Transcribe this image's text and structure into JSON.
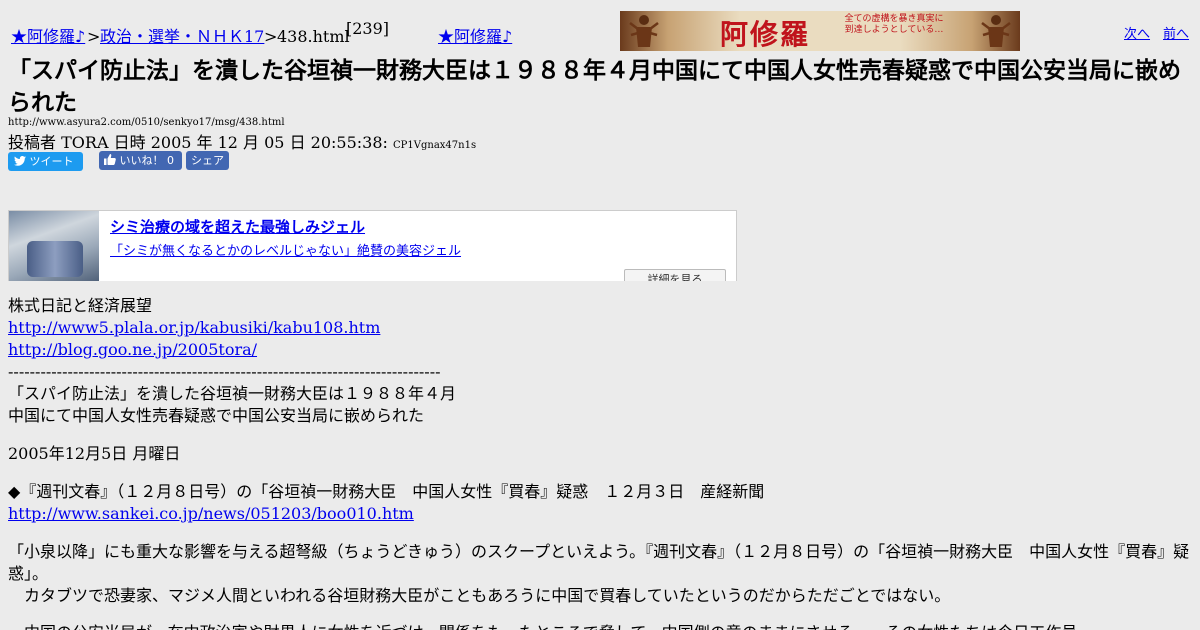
{
  "breadcrumb": {
    "home": "★阿修羅♪",
    "sep1": ">",
    "board": "政治・選挙・ＮＨＫ17",
    "sep2": ">",
    "page": "438.html",
    "count": "[239]",
    "home2": "★阿修羅♪"
  },
  "banner": {
    "title": "阿修羅",
    "tagline": "全ての虚構を暴き真実に到達しようとしている…"
  },
  "nav": {
    "next": "次へ",
    "prev": "前へ"
  },
  "headline": "「スパイ防止法」を潰した谷垣禎一財務大臣は１９８８年４月中国にて中国人女性売春疑惑で中国公安当局に嵌められた",
  "source_url": "http://www.asyura2.com/0510/senkyo17/msg/438.html",
  "post": {
    "prefix": "投稿者",
    "author": "TORA",
    "date_label": "日時",
    "date": "2005 年 12 月 05 日 20:55:38:",
    "id": "CP1Vgnax47n1s"
  },
  "social": {
    "tweet": "ツイート",
    "like": "いいね！",
    "like_count": "0",
    "share": "シェア"
  },
  "ad": {
    "title": "シミ治療の域を超えた最強しみジェル",
    "desc": "「シミが無くなるとかのレベルじゃない」絶賛の美容ジェル",
    "more": "詳細を見る"
  },
  "content": {
    "blog_name": "株式日記と経済展望",
    "link1": "http://www5.plala.or.jp/kabusiki/kabu108.htm",
    "link2": "http://blog.goo.ne.jp/2005tora/",
    "divider": "--------------------------------------------------------------------------------",
    "title_line1": "「スパイ防止法」を潰した谷垣禎一財務大臣は１９８８年４月",
    "title_line2": "中国にて中国人女性売春疑惑で中国公安当局に嵌められた",
    "date_line": "2005年12月5日 月曜日",
    "bullet_line": "◆『週刊文春』（１２月８日号）の「谷垣禎一財務大臣　中国人女性『買春』疑惑　１２月３日　産経新聞",
    "link3": "http://www.sankei.co.jp/news/051203/boo010.htm",
    "para1": "「小泉以降」にも重大な影響を与える超弩級（ちょうどきゅう）のスクープといえよう。『週刊文春』（１２月８日号）の「谷垣禎一財務大臣　中国人女性『買春』疑惑」。",
    "para2": "　カタブツで恐妻家、マジメ人間といわれる谷垣財務大臣がこともあろうに中国で買春していたというのだからただごとではない。",
    "para3": "　中国の公安当局が、在中政治家や財界人に女性を近づけ、関係をもったところで脅して、中国側の意のままにさせる——その女性たちは今日工作員"
  },
  "colors": {
    "background": "#ebebeb",
    "link": "#0000ee",
    "tweet_bg": "#1d9bf0",
    "facebook_bg": "#4267b2",
    "banner_red": "#c0141c"
  }
}
